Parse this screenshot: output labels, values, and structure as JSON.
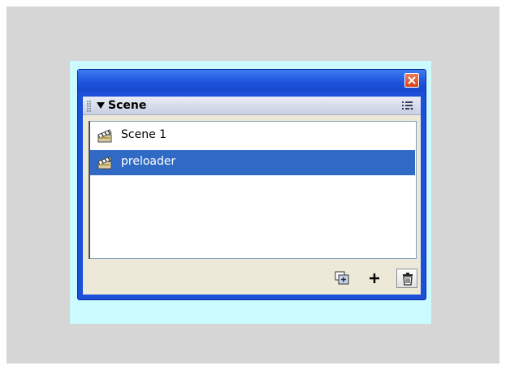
{
  "window": {
    "close_icon": "close-icon",
    "title": ""
  },
  "panel": {
    "title": "Scene",
    "options_icon": "panel-options-icon",
    "collapse_icon": "collapse-arrow-icon"
  },
  "scenes": [
    {
      "label": "Scene 1",
      "icon": "clapperboard-icon",
      "selected": false
    },
    {
      "label": "preloader",
      "icon": "clapperboard-icon",
      "selected": true
    }
  ],
  "toolbar": {
    "duplicate_icon": "duplicate-scene-icon",
    "add_icon": "add-scene-icon",
    "delete_icon": "delete-scene-icon"
  },
  "colors": {
    "titlebar": "#1c52dc",
    "selection": "#316ac5",
    "close_button": "#d8451c",
    "backdrop": "#ccfbff"
  }
}
